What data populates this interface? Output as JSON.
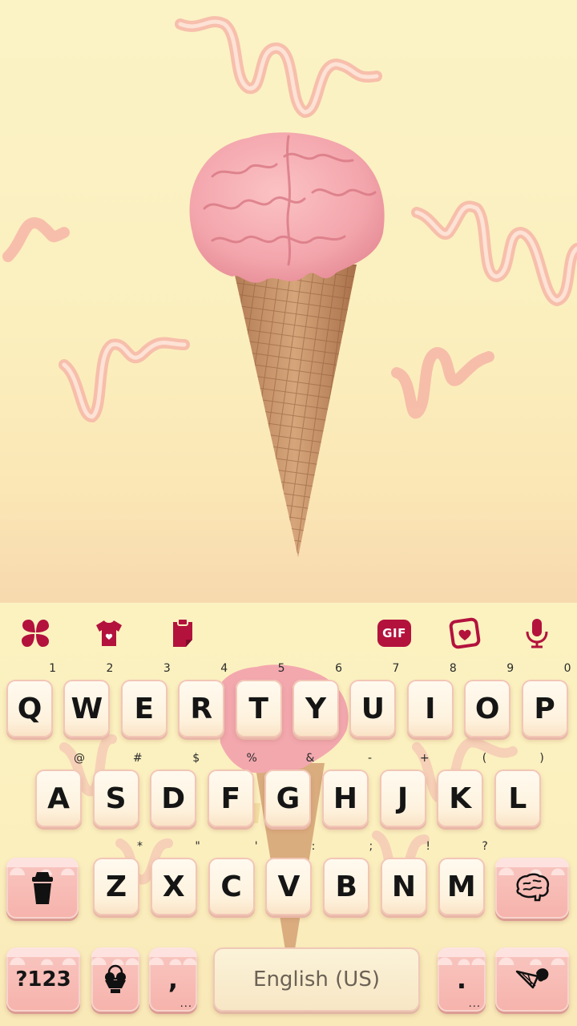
{
  "colors": {
    "accent": "#b3123d",
    "background": "#fbf0c4",
    "key_face": "#fef2dd",
    "pink_key": "#f6b3ac"
  },
  "toolbar": {
    "icons": [
      "clover-menu-icon",
      "theme-shirt-icon",
      "clipboard-icon",
      "gif-icon",
      "sticker-icon",
      "microphone-icon"
    ],
    "gif_label": "GIF"
  },
  "rows": {
    "row1": [
      {
        "k": "Q",
        "h": "1"
      },
      {
        "k": "W",
        "h": "2"
      },
      {
        "k": "E",
        "h": "3"
      },
      {
        "k": "R",
        "h": "4"
      },
      {
        "k": "T",
        "h": "5"
      },
      {
        "k": "Y",
        "h": "6"
      },
      {
        "k": "U",
        "h": "7"
      },
      {
        "k": "I",
        "h": "8"
      },
      {
        "k": "O",
        "h": "9"
      },
      {
        "k": "P",
        "h": "0"
      }
    ],
    "row2": [
      {
        "k": "A",
        "h": "@"
      },
      {
        "k": "S",
        "h": "#"
      },
      {
        "k": "D",
        "h": "$"
      },
      {
        "k": "F",
        "h": "%"
      },
      {
        "k": "G",
        "h": "&"
      },
      {
        "k": "H",
        "h": "-"
      },
      {
        "k": "J",
        "h": "+"
      },
      {
        "k": "K",
        "h": "("
      },
      {
        "k": "L",
        "h": ")"
      }
    ],
    "row3": [
      {
        "k": "Z",
        "h": "*"
      },
      {
        "k": "X",
        "h": "\""
      },
      {
        "k": "C",
        "h": "'"
      },
      {
        "k": "V",
        "h": ":"
      },
      {
        "k": "B",
        "h": ";"
      },
      {
        "k": "N",
        "h": "!"
      },
      {
        "k": "M",
        "h": "?"
      }
    ]
  },
  "keys": {
    "shift_icon": "cup-icon",
    "delete_icon": "brain-icon",
    "symbols": "?123",
    "emoji_icon": "ice-cream-cup-icon",
    "comma": ",",
    "space": "English (US)",
    "period": ".",
    "enter_icon": "ice-cream-cone-icon",
    "more_dots": "..."
  }
}
